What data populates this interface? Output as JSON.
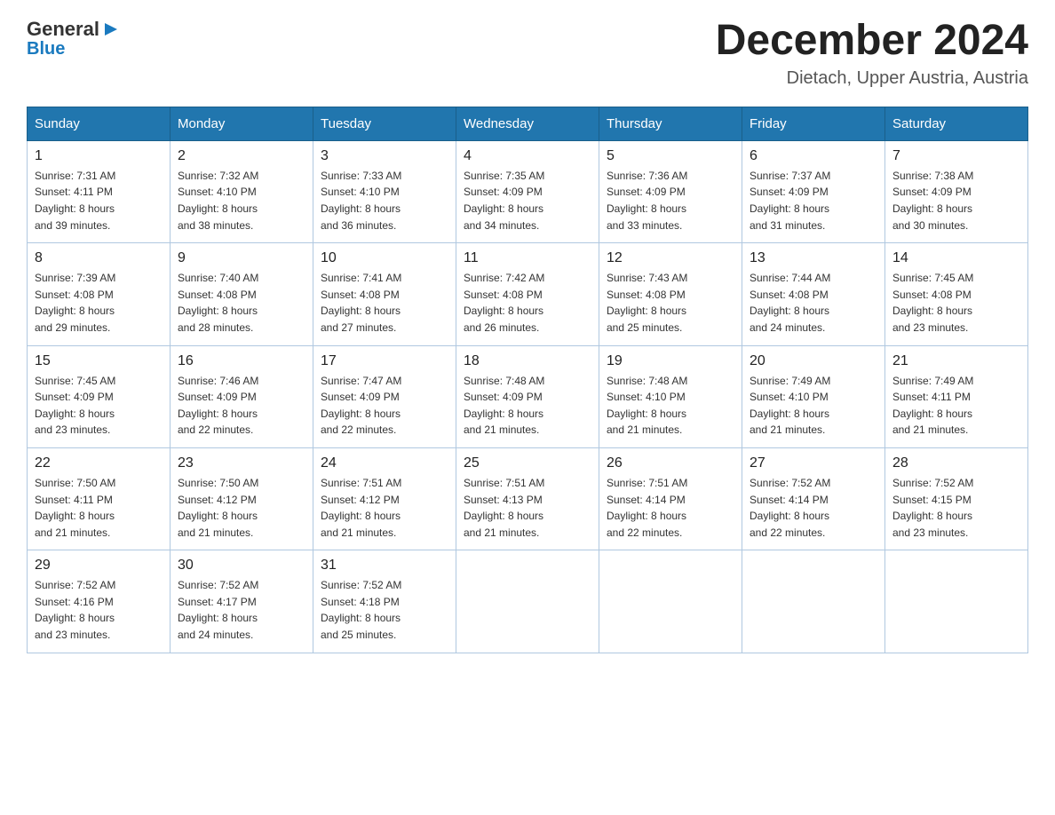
{
  "logo": {
    "text_general": "General",
    "text_blue": "Blue",
    "arrow_color": "#1a7abf"
  },
  "header": {
    "month_year": "December 2024",
    "location": "Dietach, Upper Austria, Austria"
  },
  "weekdays": [
    "Sunday",
    "Monday",
    "Tuesday",
    "Wednesday",
    "Thursday",
    "Friday",
    "Saturday"
  ],
  "weeks": [
    [
      {
        "day": "1",
        "sunrise": "7:31 AM",
        "sunset": "4:11 PM",
        "daylight": "8 hours and 39 minutes."
      },
      {
        "day": "2",
        "sunrise": "7:32 AM",
        "sunset": "4:10 PM",
        "daylight": "8 hours and 38 minutes."
      },
      {
        "day": "3",
        "sunrise": "7:33 AM",
        "sunset": "4:10 PM",
        "daylight": "8 hours and 36 minutes."
      },
      {
        "day": "4",
        "sunrise": "7:35 AM",
        "sunset": "4:09 PM",
        "daylight": "8 hours and 34 minutes."
      },
      {
        "day": "5",
        "sunrise": "7:36 AM",
        "sunset": "4:09 PM",
        "daylight": "8 hours and 33 minutes."
      },
      {
        "day": "6",
        "sunrise": "7:37 AM",
        "sunset": "4:09 PM",
        "daylight": "8 hours and 31 minutes."
      },
      {
        "day": "7",
        "sunrise": "7:38 AM",
        "sunset": "4:09 PM",
        "daylight": "8 hours and 30 minutes."
      }
    ],
    [
      {
        "day": "8",
        "sunrise": "7:39 AM",
        "sunset": "4:08 PM",
        "daylight": "8 hours and 29 minutes."
      },
      {
        "day": "9",
        "sunrise": "7:40 AM",
        "sunset": "4:08 PM",
        "daylight": "8 hours and 28 minutes."
      },
      {
        "day": "10",
        "sunrise": "7:41 AM",
        "sunset": "4:08 PM",
        "daylight": "8 hours and 27 minutes."
      },
      {
        "day": "11",
        "sunrise": "7:42 AM",
        "sunset": "4:08 PM",
        "daylight": "8 hours and 26 minutes."
      },
      {
        "day": "12",
        "sunrise": "7:43 AM",
        "sunset": "4:08 PM",
        "daylight": "8 hours and 25 minutes."
      },
      {
        "day": "13",
        "sunrise": "7:44 AM",
        "sunset": "4:08 PM",
        "daylight": "8 hours and 24 minutes."
      },
      {
        "day": "14",
        "sunrise": "7:45 AM",
        "sunset": "4:08 PM",
        "daylight": "8 hours and 23 minutes."
      }
    ],
    [
      {
        "day": "15",
        "sunrise": "7:45 AM",
        "sunset": "4:09 PM",
        "daylight": "8 hours and 23 minutes."
      },
      {
        "day": "16",
        "sunrise": "7:46 AM",
        "sunset": "4:09 PM",
        "daylight": "8 hours and 22 minutes."
      },
      {
        "day": "17",
        "sunrise": "7:47 AM",
        "sunset": "4:09 PM",
        "daylight": "8 hours and 22 minutes."
      },
      {
        "day": "18",
        "sunrise": "7:48 AM",
        "sunset": "4:09 PM",
        "daylight": "8 hours and 21 minutes."
      },
      {
        "day": "19",
        "sunrise": "7:48 AM",
        "sunset": "4:10 PM",
        "daylight": "8 hours and 21 minutes."
      },
      {
        "day": "20",
        "sunrise": "7:49 AM",
        "sunset": "4:10 PM",
        "daylight": "8 hours and 21 minutes."
      },
      {
        "day": "21",
        "sunrise": "7:49 AM",
        "sunset": "4:11 PM",
        "daylight": "8 hours and 21 minutes."
      }
    ],
    [
      {
        "day": "22",
        "sunrise": "7:50 AM",
        "sunset": "4:11 PM",
        "daylight": "8 hours and 21 minutes."
      },
      {
        "day": "23",
        "sunrise": "7:50 AM",
        "sunset": "4:12 PM",
        "daylight": "8 hours and 21 minutes."
      },
      {
        "day": "24",
        "sunrise": "7:51 AM",
        "sunset": "4:12 PM",
        "daylight": "8 hours and 21 minutes."
      },
      {
        "day": "25",
        "sunrise": "7:51 AM",
        "sunset": "4:13 PM",
        "daylight": "8 hours and 21 minutes."
      },
      {
        "day": "26",
        "sunrise": "7:51 AM",
        "sunset": "4:14 PM",
        "daylight": "8 hours and 22 minutes."
      },
      {
        "day": "27",
        "sunrise": "7:52 AM",
        "sunset": "4:14 PM",
        "daylight": "8 hours and 22 minutes."
      },
      {
        "day": "28",
        "sunrise": "7:52 AM",
        "sunset": "4:15 PM",
        "daylight": "8 hours and 23 minutes."
      }
    ],
    [
      {
        "day": "29",
        "sunrise": "7:52 AM",
        "sunset": "4:16 PM",
        "daylight": "8 hours and 23 minutes."
      },
      {
        "day": "30",
        "sunrise": "7:52 AM",
        "sunset": "4:17 PM",
        "daylight": "8 hours and 24 minutes."
      },
      {
        "day": "31",
        "sunrise": "7:52 AM",
        "sunset": "4:18 PM",
        "daylight": "8 hours and 25 minutes."
      },
      null,
      null,
      null,
      null
    ]
  ]
}
